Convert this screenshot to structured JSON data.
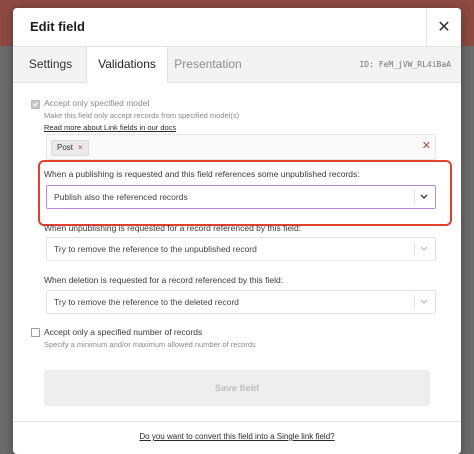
{
  "modal": {
    "title": "Edit field",
    "close_symbol": "✕"
  },
  "tabs": [
    {
      "label": "Settings",
      "active": false
    },
    {
      "label": "Validations",
      "active": true
    },
    {
      "label": "Presentation",
      "active": false
    }
  ],
  "field_id": "ID: FeM_jVW_RL4iBaA",
  "model_validation": {
    "checked": true,
    "label": "Accept only specified model",
    "hint": "Make this field only accept records from specified model(s)",
    "link": "Read more about Link fields in our docs",
    "selected_models": [
      "Post"
    ],
    "chip_remove": "×",
    "clear_symbol": "✕"
  },
  "publishing": {
    "label": "When a publishing is requested and this field references some unpublished records:",
    "value": "Publish also the referenced records"
  },
  "unpublishing": {
    "label": "When unpublishing is requested for a record referenced by this field:",
    "value": "Try to remove the reference to the unpublished record"
  },
  "deletion": {
    "label": "When deletion is requested for a record referenced by this field:",
    "value": "Try to remove the reference to the deleted record"
  },
  "number_validation": {
    "checked": false,
    "label": "Accept only a specified number of records",
    "hint": "Specify a minimum and/or maximum allowed number of records"
  },
  "save_button": "Save field",
  "convert_link": "Do you want to convert this field into a Single link field?",
  "colors": {
    "highlight": "#e0402f",
    "active_border": "#b58ad9",
    "clear_icon": "#b24a3e"
  }
}
